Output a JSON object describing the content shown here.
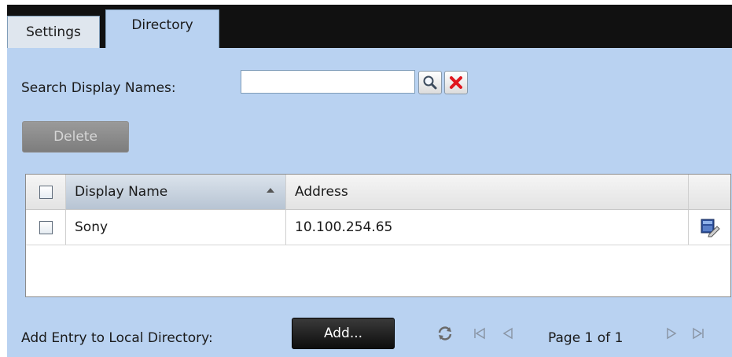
{
  "tabs": [
    {
      "label": "Settings"
    },
    {
      "label": "Directory"
    }
  ],
  "search": {
    "label": "Search Display Names:",
    "value": "",
    "search_icon": "magnifier-icon",
    "clear_icon": "red-x-icon"
  },
  "delete_button": {
    "label": "Delete"
  },
  "table": {
    "columns": [
      "Display Name",
      "Address"
    ],
    "rows": [
      {
        "display_name": "Sony",
        "address": "10.100.254.65"
      }
    ]
  },
  "footer": {
    "add_label": "Add Entry to Local Directory:",
    "add_button": "Add...",
    "page_text": "Page 1 of 1"
  },
  "colors": {
    "panel": "#b9d2f1",
    "tab_bar": "#111111",
    "clear_red": "#e0161e"
  }
}
